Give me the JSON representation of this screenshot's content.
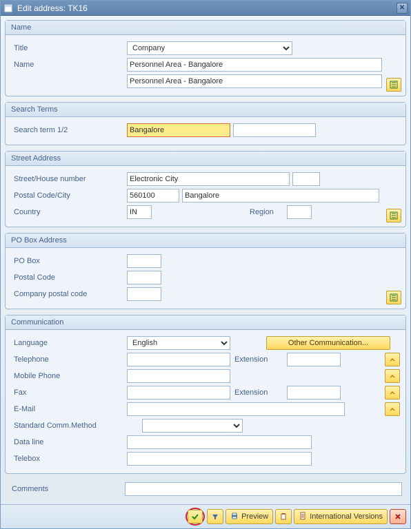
{
  "window": {
    "title": "Edit address:  TK16"
  },
  "name_group": {
    "header": "Name",
    "title_label": "Title",
    "title_value": "Company",
    "name_label": "Name",
    "name_value1": "Personnel Area - Bangalore",
    "name_value2": "Personnel Area - Bangalore"
  },
  "search_group": {
    "header": "Search Terms",
    "term_label": "Search term 1/2",
    "term1_value": "Bangalore",
    "term2_value": ""
  },
  "street_group": {
    "header": "Street Address",
    "street_label": "Street/House number",
    "street_value": "Electronic City",
    "house_value": "",
    "postal_label": "Postal Code/City",
    "postal_value": "560100",
    "city_value": "Bangalore",
    "country_label": "Country",
    "country_value": "IN",
    "region_label": "Region",
    "region_value": ""
  },
  "pobox_group": {
    "header": "PO Box Address",
    "pobox_label": "PO Box",
    "pobox_value": "",
    "postal_label": "Postal Code",
    "postal_value": "",
    "company_label": "Company postal code",
    "company_value": ""
  },
  "comm_group": {
    "header": "Communication",
    "lang_label": "Language",
    "lang_value": "English",
    "other_btn": "Other Communication...",
    "tel_label": "Telephone",
    "tel_value": "",
    "ext_label": "Extension",
    "tel_ext_value": "",
    "mobile_label": "Mobile Phone",
    "mobile_value": "",
    "fax_label": "Fax",
    "fax_value": "",
    "fax_ext_value": "",
    "email_label": "E-Mail",
    "email_value": "",
    "std_label": "Standard Comm.Method",
    "std_value": "",
    "dataline_label": "Data line",
    "dataline_value": "",
    "telebox_label": "Telebox",
    "telebox_value": ""
  },
  "comments": {
    "label": "Comments",
    "value": ""
  },
  "footer": {
    "preview": "Preview",
    "intl": "International Versions"
  }
}
